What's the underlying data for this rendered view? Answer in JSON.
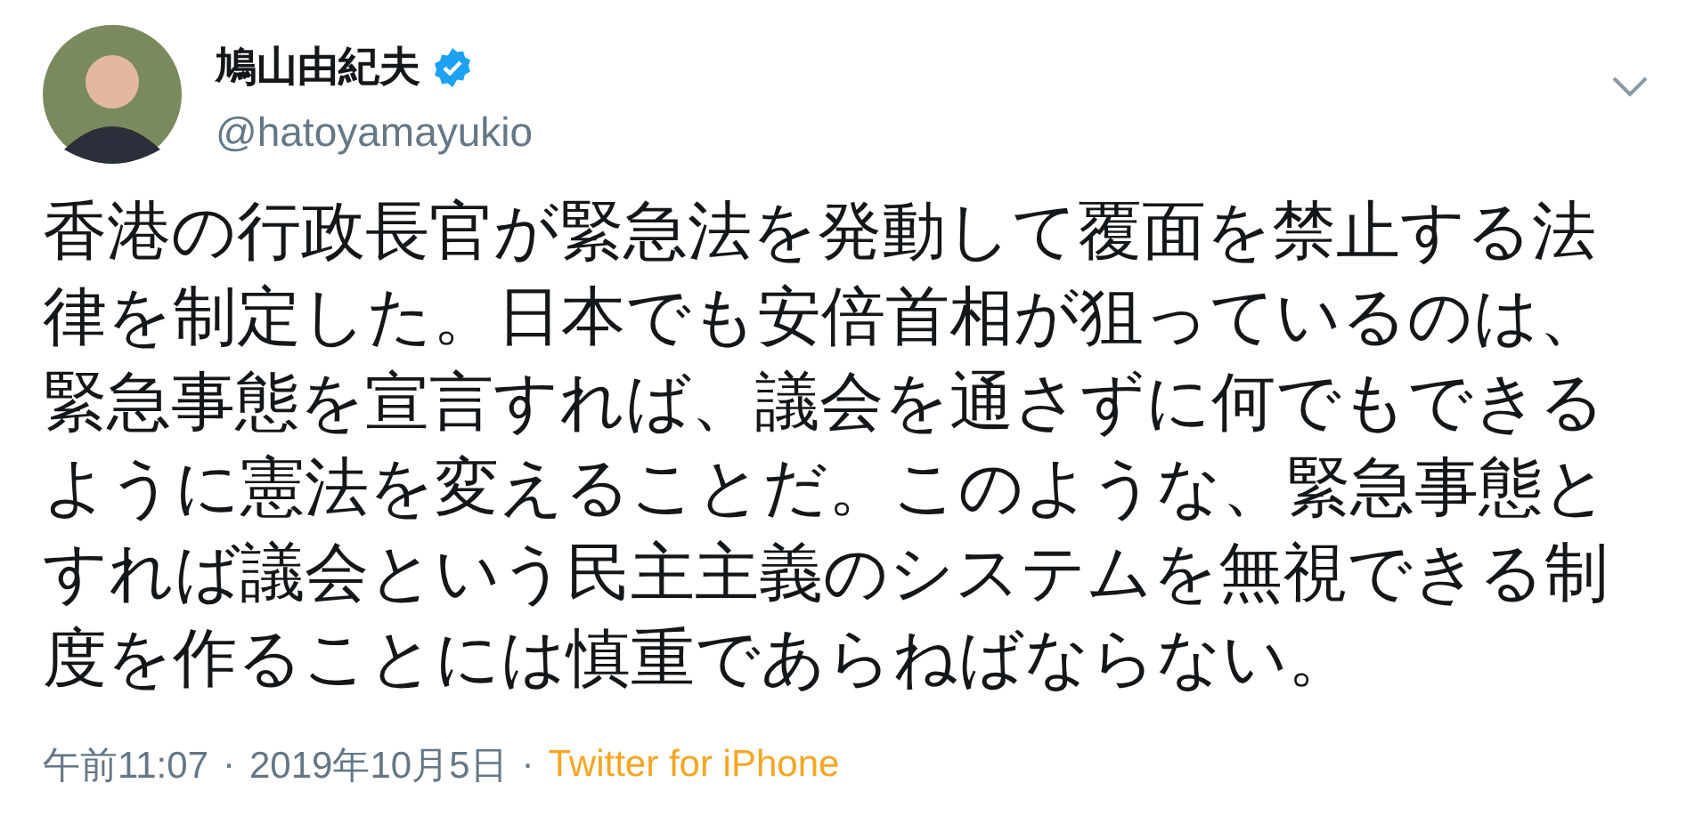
{
  "author": {
    "name": "鳩山由紀夫",
    "verified": true,
    "handle": "@hatoyamayukio"
  },
  "text": "香港の行政長官が緊急法を発動して覆面を禁止する法律を制定した。日本でも安倍首相が狙っているのは、緊急事態を宣言すれば、議会を通さずに何でもできるように憲法を変えることだ。このような、緊急事態とすれば議会という民主主義のシステムを無視できる制度を作ることには慎重であらねばならない。",
  "footer": {
    "time": "午前11:07",
    "separator_1": "·",
    "date": "2019年10月5日",
    "separator_2": "·",
    "source": "Twitter for iPhone"
  }
}
